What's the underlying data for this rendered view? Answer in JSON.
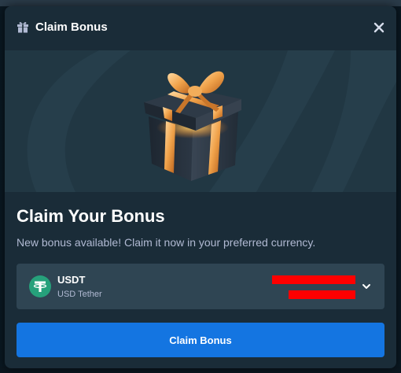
{
  "header": {
    "title": "Claim Bonus",
    "icon": "gift-icon",
    "close_icon": "close-icon"
  },
  "hero": {
    "image": "gift-box-illustration"
  },
  "body": {
    "title": "Claim Your Bonus",
    "subtitle": "New bonus available! Claim it now in your preferred currency."
  },
  "currency": {
    "code": "USDT",
    "name": "USD Tether",
    "icon": "tether-icon",
    "dropdown_icon": "chevron-down-icon"
  },
  "actions": {
    "claim_label": "Claim Bonus"
  },
  "colors": {
    "modal_bg": "#1a2c38",
    "hero_bg": "#213743",
    "select_bg": "#2f4553",
    "primary_button": "#1475e1",
    "tether_green": "#26a17b",
    "subtitle_text": "#b1bad3",
    "redaction": "#ff0000"
  }
}
